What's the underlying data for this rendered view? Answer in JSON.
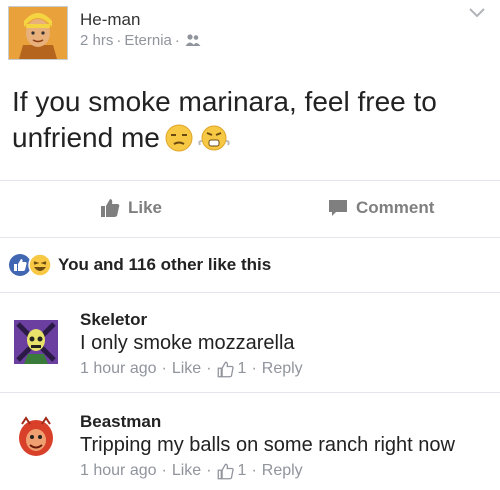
{
  "post": {
    "author": "He-man",
    "time": "2 hrs",
    "location": "Eternia",
    "text": "If you smoke marinara, feel free to unfriend me",
    "emoji_icons": [
      "unamused-face-icon",
      "steaming-angry-face-icon"
    ]
  },
  "actions": {
    "like_label": "Like",
    "comment_label": "Comment"
  },
  "reactions": {
    "summary": "You and 116 other like this"
  },
  "comments": [
    {
      "author": "Skeletor",
      "text": "I only smoke mozzarella",
      "time": "1 hour ago",
      "like_label": "Like",
      "like_count": "1",
      "reply_label": "Reply"
    },
    {
      "author": "Beastman",
      "text": "Tripping my balls on some ranch right now",
      "time": "1 hour ago",
      "like_label": "Like",
      "like_count": "1",
      "reply_label": "Reply"
    }
  ],
  "colors": {
    "accent": "#4267b2",
    "meta_gray": "#90949c",
    "action_gray": "#7f7f7f",
    "separator": "#e4e6eb"
  }
}
